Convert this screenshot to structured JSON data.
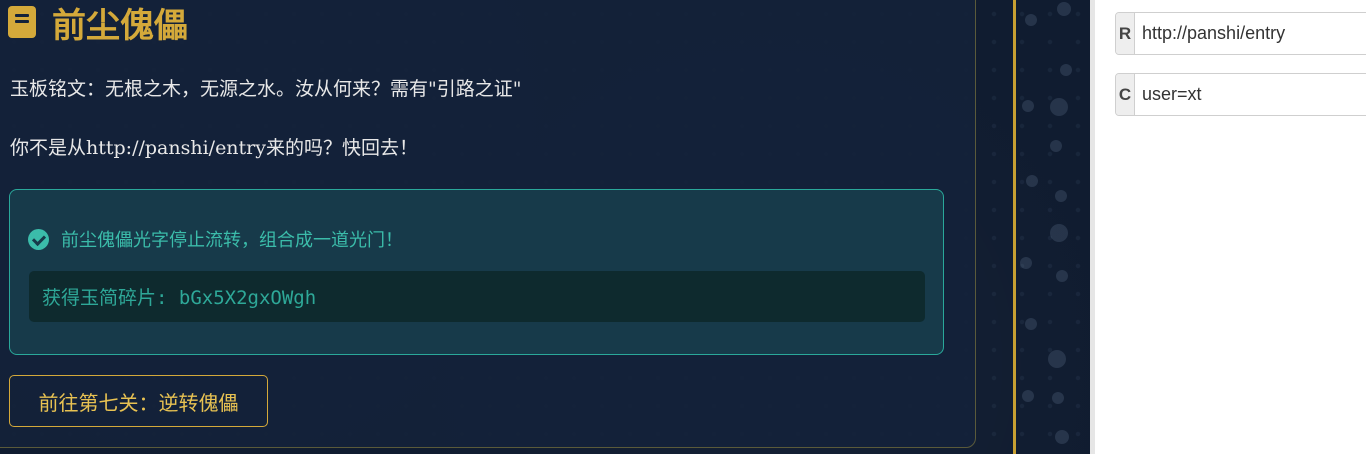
{
  "game": {
    "title": "前尘傀儡",
    "inscription": "玉板铭文：无根之木，无源之水。汝从何来？需有\"引路之证\"",
    "warning": "你不是从http://panshi/entry来的吗？快回去！",
    "success_message": "前尘傀儡光字停止流转，组合成一道光门！",
    "fragment_text": "获得玉简碎片: bGx5X2gxOWgh",
    "next_button": "前往第七关：逆转傀儡",
    "colors": {
      "accent_gold": "#d4a93a",
      "success_teal": "#3bbcaa",
      "background": "#101c30"
    },
    "icons": {
      "title_icon": "book-icon",
      "success_icon": "check-circle-icon"
    }
  },
  "panel": {
    "referer": {
      "tag": "R",
      "value": "http://panshi/entry"
    },
    "cookie": {
      "tag": "C",
      "value": "user=xt"
    }
  }
}
